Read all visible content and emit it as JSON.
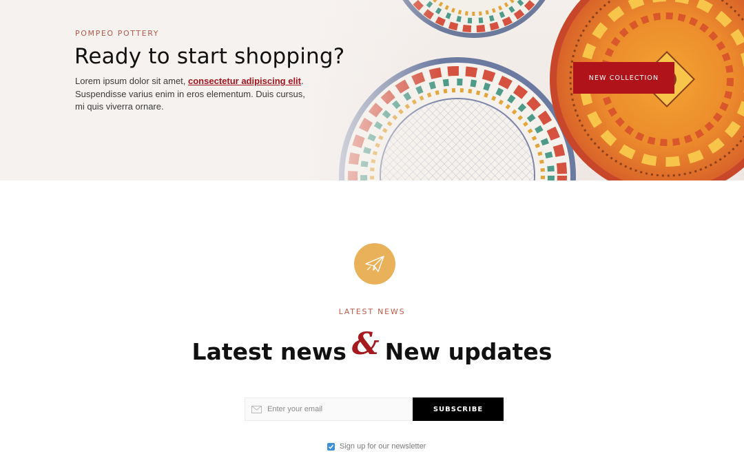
{
  "hero": {
    "eyebrow": "POMPEO POTTERY",
    "title": "Ready to start shopping?",
    "text_before": "Lorem ipsum dolor sit amet, ",
    "link": "consectetur adipiscing elit",
    "text_after": ". Suspendisse varius enim in eros elementum. Duis cursus, mi quis viverra ornare.",
    "cta_label": "NEW COLLECTION",
    "cta_color": "#b0141a"
  },
  "newsletter": {
    "icon": "paper-plane-icon",
    "icon_bg": "#e8b15a",
    "eyebrow": "LATEST NEWS",
    "title_left": "Latest news",
    "ampersand": "&",
    "title_right": "New updates",
    "email_placeholder": "Enter your email",
    "email_icon": "envelope-icon",
    "subscribe_label": "SUBSCRIBE",
    "checkbox_checked": true,
    "checkbox_label": "Sign up for our newsletter"
  }
}
